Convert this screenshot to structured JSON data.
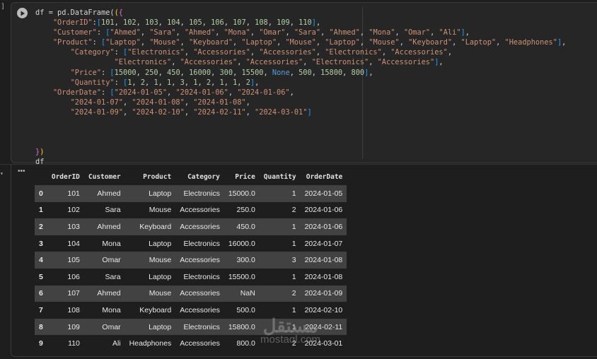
{
  "gutter_mark": "]",
  "code_lines": [
    [
      [
        "",
        "df = pd.DataFrame("
      ],
      [
        "b1",
        "("
      ],
      [
        "b2",
        "{"
      ]
    ],
    [
      [
        "",
        "    "
      ],
      [
        "str",
        "\"OrderID\""
      ],
      [
        "",
        ":"
      ],
      [
        "b3",
        "["
      ],
      [
        "num",
        "101"
      ],
      [
        "",
        ", "
      ],
      [
        "num",
        "102"
      ],
      [
        "",
        ", "
      ],
      [
        "num",
        "103"
      ],
      [
        "",
        ", "
      ],
      [
        "num",
        "104"
      ],
      [
        "",
        ", "
      ],
      [
        "num",
        "105"
      ],
      [
        "",
        ", "
      ],
      [
        "num",
        "106"
      ],
      [
        "",
        ", "
      ],
      [
        "num",
        "107"
      ],
      [
        "",
        ", "
      ],
      [
        "num",
        "108"
      ],
      [
        "",
        ", "
      ],
      [
        "num",
        "109"
      ],
      [
        "",
        ", "
      ],
      [
        "num",
        "110"
      ],
      [
        "b3",
        "]"
      ],
      [
        "",
        ","
      ]
    ],
    [
      [
        "",
        "    "
      ],
      [
        "str",
        "\"Customer\""
      ],
      [
        "",
        ": "
      ],
      [
        "b3",
        "["
      ],
      [
        "str",
        "\"Ahmed\""
      ],
      [
        "",
        ", "
      ],
      [
        "str",
        "\"Sara\""
      ],
      [
        "",
        ", "
      ],
      [
        "str",
        "\"Ahmed\""
      ],
      [
        "",
        ", "
      ],
      [
        "str",
        "\"Mona\""
      ],
      [
        "",
        ", "
      ],
      [
        "str",
        "\"Omar\""
      ],
      [
        "",
        ", "
      ],
      [
        "str",
        "\"Sara\""
      ],
      [
        "",
        ", "
      ],
      [
        "str",
        "\"Ahmed\""
      ],
      [
        "",
        ", "
      ],
      [
        "str",
        "\"Mona\""
      ],
      [
        "",
        ", "
      ],
      [
        "str",
        "\"Omar\""
      ],
      [
        "",
        ", "
      ],
      [
        "str",
        "\"Ali\""
      ],
      [
        "b3",
        "]"
      ],
      [
        "",
        ","
      ]
    ],
    [
      [
        "",
        "    "
      ],
      [
        "str",
        "\"Product\""
      ],
      [
        "",
        ": "
      ],
      [
        "b3",
        "["
      ],
      [
        "str",
        "\"Laptop\""
      ],
      [
        "",
        ", "
      ],
      [
        "str",
        "\"Mouse\""
      ],
      [
        "",
        ", "
      ],
      [
        "str",
        "\"Keyboard\""
      ],
      [
        "",
        ", "
      ],
      [
        "str",
        "\"Laptop\""
      ],
      [
        "",
        ", "
      ],
      [
        "str",
        "\"Mouse\""
      ],
      [
        "",
        ", "
      ],
      [
        "str",
        "\"Laptop\""
      ],
      [
        "",
        ", "
      ],
      [
        "str",
        "\"Mouse\""
      ],
      [
        "",
        ", "
      ],
      [
        "str",
        "\"Keyboard\""
      ],
      [
        "",
        ", "
      ],
      [
        "str",
        "\"Laptop\""
      ],
      [
        "",
        ", "
      ],
      [
        "str",
        "\"Headphones\""
      ],
      [
        "b3",
        "]"
      ],
      [
        "",
        ","
      ]
    ],
    [
      [
        "",
        "        "
      ],
      [
        "str",
        "\"Category\""
      ],
      [
        "",
        ": "
      ],
      [
        "b3",
        "["
      ],
      [
        "str",
        "\"Electronics\""
      ],
      [
        "",
        ", "
      ],
      [
        "str",
        "\"Accessories\""
      ],
      [
        "",
        ", "
      ],
      [
        "str",
        "\"Accessories\""
      ],
      [
        "",
        ", "
      ],
      [
        "str",
        "\"Electronics\""
      ],
      [
        "",
        ", "
      ],
      [
        "str",
        "\"Accessories\""
      ],
      [
        "",
        ","
      ]
    ],
    [
      [
        "",
        "                  "
      ],
      [
        "str",
        "\"Electronics\""
      ],
      [
        "",
        ", "
      ],
      [
        "str",
        "\"Accessories\""
      ],
      [
        "",
        ", "
      ],
      [
        "str",
        "\"Accessories\""
      ],
      [
        "",
        ", "
      ],
      [
        "str",
        "\"Electronics\""
      ],
      [
        "",
        ", "
      ],
      [
        "str",
        "\"Accessories\""
      ],
      [
        "b3",
        "]"
      ],
      [
        "",
        ","
      ]
    ],
    [
      [
        "",
        "        "
      ],
      [
        "str",
        "\"Price\""
      ],
      [
        "",
        ": "
      ],
      [
        "b3",
        "["
      ],
      [
        "num",
        "15000"
      ],
      [
        "",
        ", "
      ],
      [
        "num",
        "250"
      ],
      [
        "",
        ", "
      ],
      [
        "num",
        "450"
      ],
      [
        "",
        ", "
      ],
      [
        "num",
        "16000"
      ],
      [
        "",
        ", "
      ],
      [
        "num",
        "300"
      ],
      [
        "",
        ", "
      ],
      [
        "num",
        "15500"
      ],
      [
        "",
        ", "
      ],
      [
        "kw",
        "None"
      ],
      [
        "",
        ", "
      ],
      [
        "num",
        "500"
      ],
      [
        "",
        ", "
      ],
      [
        "num",
        "15800"
      ],
      [
        "",
        ", "
      ],
      [
        "num",
        "800"
      ],
      [
        "b3",
        "]"
      ],
      [
        "",
        ","
      ]
    ],
    [
      [
        "",
        "        "
      ],
      [
        "str",
        "\"Quantity\""
      ],
      [
        "",
        ": "
      ],
      [
        "b3",
        "["
      ],
      [
        "num",
        "1"
      ],
      [
        "",
        ", "
      ],
      [
        "num",
        "2"
      ],
      [
        "",
        ", "
      ],
      [
        "num",
        "1"
      ],
      [
        "",
        ", "
      ],
      [
        "num",
        "1"
      ],
      [
        "",
        ", "
      ],
      [
        "num",
        "3"
      ],
      [
        "",
        ", "
      ],
      [
        "num",
        "1"
      ],
      [
        "",
        ", "
      ],
      [
        "num",
        "2"
      ],
      [
        "",
        ", "
      ],
      [
        "num",
        "1"
      ],
      [
        "",
        ", "
      ],
      [
        "num",
        "1"
      ],
      [
        "",
        ", "
      ],
      [
        "num",
        "2"
      ],
      [
        "b3",
        "]"
      ],
      [
        "",
        ","
      ]
    ],
    [
      [
        "",
        "    "
      ],
      [
        "str",
        "\"OrderDate\""
      ],
      [
        "",
        ": "
      ],
      [
        "b3",
        "["
      ],
      [
        "str",
        "\"2024-01-05\""
      ],
      [
        "",
        ", "
      ],
      [
        "str",
        "\"2024-01-06\""
      ],
      [
        "",
        ", "
      ],
      [
        "str",
        "\"2024-01-06\""
      ],
      [
        "",
        ","
      ]
    ],
    [
      [
        "",
        "        "
      ],
      [
        "str",
        "\"2024-01-07\""
      ],
      [
        "",
        ", "
      ],
      [
        "str",
        "\"2024-01-08\""
      ],
      [
        "",
        ", "
      ],
      [
        "str",
        "\"2024-01-08\""
      ],
      [
        "",
        ","
      ]
    ],
    [
      [
        "",
        "        "
      ],
      [
        "str",
        "\"2024-01-09\""
      ],
      [
        "",
        ", "
      ],
      [
        "str",
        "\"2024-02-10\""
      ],
      [
        "",
        ", "
      ],
      [
        "str",
        "\"2024-02-11\""
      ],
      [
        "",
        ", "
      ],
      [
        "str",
        "\"2024-03-01\""
      ],
      [
        "b3",
        "]"
      ]
    ],
    [
      [
        "",
        ""
      ]
    ],
    [
      [
        "",
        ""
      ]
    ],
    [
      [
        "",
        ""
      ]
    ],
    [
      [
        "b2",
        "}"
      ],
      [
        "b1",
        ")"
      ]
    ],
    [
      [
        "",
        "df"
      ]
    ]
  ],
  "output": {
    "menu_label": "•••",
    "columns": [
      "",
      "OrderID",
      "Customer",
      "Product",
      "Category",
      "Price",
      "Quantity",
      "OrderDate"
    ],
    "rows": [
      [
        "0",
        "101",
        "Ahmed",
        "Laptop",
        "Electronics",
        "15000.0",
        "1",
        "2024-01-05"
      ],
      [
        "1",
        "102",
        "Sara",
        "Mouse",
        "Accessories",
        "250.0",
        "2",
        "2024-01-06"
      ],
      [
        "2",
        "103",
        "Ahmed",
        "Keyboard",
        "Accessories",
        "450.0",
        "1",
        "2024-01-06"
      ],
      [
        "3",
        "104",
        "Mona",
        "Laptop",
        "Electronics",
        "16000.0",
        "1",
        "2024-01-07"
      ],
      [
        "4",
        "105",
        "Omar",
        "Mouse",
        "Accessories",
        "300.0",
        "3",
        "2024-01-08"
      ],
      [
        "5",
        "106",
        "Sara",
        "Laptop",
        "Electronics",
        "15500.0",
        "1",
        "2024-01-08"
      ],
      [
        "6",
        "107",
        "Ahmed",
        "Mouse",
        "Accessories",
        "NaN",
        "2",
        "2024-01-09"
      ],
      [
        "7",
        "108",
        "Mona",
        "Keyboard",
        "Accessories",
        "500.0",
        "1",
        "2024-02-10"
      ],
      [
        "8",
        "109",
        "Omar",
        "Laptop",
        "Electronics",
        "15800.0",
        "1",
        "2024-02-11"
      ],
      [
        "9",
        "110",
        "Ali",
        "Headphones",
        "Accessories",
        "800.0",
        "2",
        "2024-03-01"
      ]
    ]
  },
  "watermark": {
    "arabic": "مستقل",
    "latin": "mostaql.com"
  }
}
